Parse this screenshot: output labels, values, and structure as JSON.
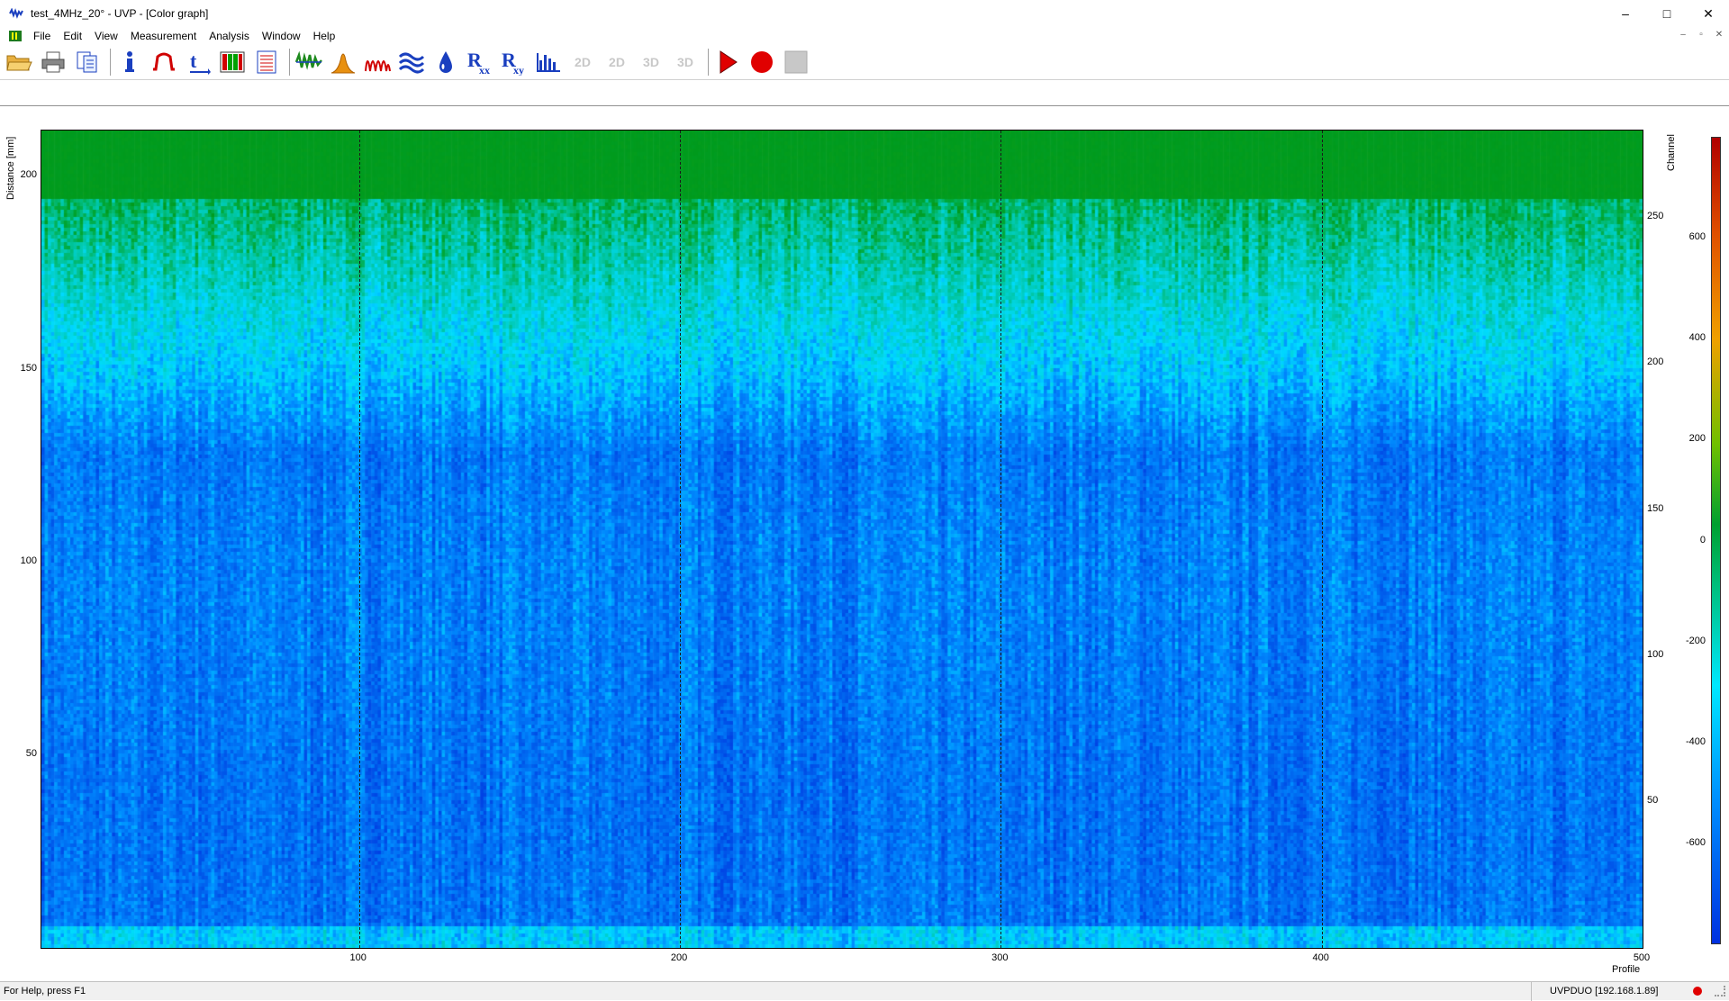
{
  "window": {
    "title": "test_4MHz_20° - UVP - [Color graph]",
    "minimize": "–",
    "maximize": "□",
    "close": "✕"
  },
  "menu": [
    "File",
    "Edit",
    "View",
    "Measurement",
    "Analysis",
    "Window",
    "Help"
  ],
  "mdi": {
    "minimize": "–",
    "restore": "▫",
    "close": "✕"
  },
  "toolbar": {
    "disabled_labels": [
      "2D",
      "2D",
      "3D",
      "3D"
    ],
    "rxx": "R",
    "rxx_sub": "xx",
    "rxy": "R",
    "rxy_sub": "xy"
  },
  "colors": {
    "accent_play": "#e00000",
    "toolbar_blue": "#1a3fbf"
  },
  "chart_data": {
    "type": "heatmap",
    "xlabel": "Profile",
    "ylabel": "Distance [mm]",
    "y2label": "Channel",
    "xlim": [
      1,
      500
    ],
    "ylim": [
      0,
      212
    ],
    "y2lim": [
      0,
      280
    ],
    "x_ticks": [
      100,
      200,
      300,
      400,
      500
    ],
    "y_ticks": [
      50,
      100,
      150,
      200
    ],
    "y2_ticks": [
      50,
      100,
      150,
      200,
      250
    ],
    "colorbar_ticks": [
      600,
      400,
      200,
      0,
      -200,
      -400,
      -600
    ],
    "colorbar_range": [
      -800,
      800
    ],
    "grid": "vertical dashed at x ticks",
    "description_bands": [
      {
        "distance_from": 195,
        "distance_to": 212,
        "value_level": 0
      },
      {
        "distance_from": 160,
        "distance_to": 195,
        "value_level": -150
      },
      {
        "distance_from": 130,
        "distance_to": 160,
        "value_level": -350
      },
      {
        "distance_from": 5,
        "distance_to": 130,
        "value_level": -600
      },
      {
        "distance_from": 0,
        "distance_to": 5,
        "value_level": -400
      }
    ]
  },
  "status": {
    "help": "For Help, press F1",
    "device": "UVPDUO [192.168.1.89]"
  }
}
